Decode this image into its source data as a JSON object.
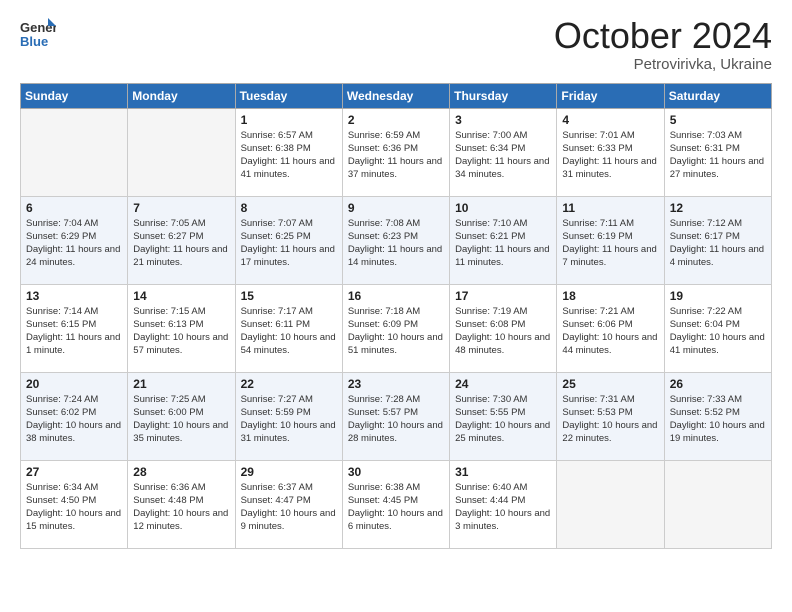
{
  "header": {
    "logo_general": "General",
    "logo_blue": "Blue",
    "month": "October 2024",
    "location": "Petrovirivka, Ukraine"
  },
  "weekdays": [
    "Sunday",
    "Monday",
    "Tuesday",
    "Wednesday",
    "Thursday",
    "Friday",
    "Saturday"
  ],
  "weeks": [
    [
      {
        "day": "",
        "info": ""
      },
      {
        "day": "",
        "info": ""
      },
      {
        "day": "1",
        "info": "Sunrise: 6:57 AM\nSunset: 6:38 PM\nDaylight: 11 hours and 41 minutes."
      },
      {
        "day": "2",
        "info": "Sunrise: 6:59 AM\nSunset: 6:36 PM\nDaylight: 11 hours and 37 minutes."
      },
      {
        "day": "3",
        "info": "Sunrise: 7:00 AM\nSunset: 6:34 PM\nDaylight: 11 hours and 34 minutes."
      },
      {
        "day": "4",
        "info": "Sunrise: 7:01 AM\nSunset: 6:33 PM\nDaylight: 11 hours and 31 minutes."
      },
      {
        "day": "5",
        "info": "Sunrise: 7:03 AM\nSunset: 6:31 PM\nDaylight: 11 hours and 27 minutes."
      }
    ],
    [
      {
        "day": "6",
        "info": "Sunrise: 7:04 AM\nSunset: 6:29 PM\nDaylight: 11 hours and 24 minutes."
      },
      {
        "day": "7",
        "info": "Sunrise: 7:05 AM\nSunset: 6:27 PM\nDaylight: 11 hours and 21 minutes."
      },
      {
        "day": "8",
        "info": "Sunrise: 7:07 AM\nSunset: 6:25 PM\nDaylight: 11 hours and 17 minutes."
      },
      {
        "day": "9",
        "info": "Sunrise: 7:08 AM\nSunset: 6:23 PM\nDaylight: 11 hours and 14 minutes."
      },
      {
        "day": "10",
        "info": "Sunrise: 7:10 AM\nSunset: 6:21 PM\nDaylight: 11 hours and 11 minutes."
      },
      {
        "day": "11",
        "info": "Sunrise: 7:11 AM\nSunset: 6:19 PM\nDaylight: 11 hours and 7 minutes."
      },
      {
        "day": "12",
        "info": "Sunrise: 7:12 AM\nSunset: 6:17 PM\nDaylight: 11 hours and 4 minutes."
      }
    ],
    [
      {
        "day": "13",
        "info": "Sunrise: 7:14 AM\nSunset: 6:15 PM\nDaylight: 11 hours and 1 minute."
      },
      {
        "day": "14",
        "info": "Sunrise: 7:15 AM\nSunset: 6:13 PM\nDaylight: 10 hours and 57 minutes."
      },
      {
        "day": "15",
        "info": "Sunrise: 7:17 AM\nSunset: 6:11 PM\nDaylight: 10 hours and 54 minutes."
      },
      {
        "day": "16",
        "info": "Sunrise: 7:18 AM\nSunset: 6:09 PM\nDaylight: 10 hours and 51 minutes."
      },
      {
        "day": "17",
        "info": "Sunrise: 7:19 AM\nSunset: 6:08 PM\nDaylight: 10 hours and 48 minutes."
      },
      {
        "day": "18",
        "info": "Sunrise: 7:21 AM\nSunset: 6:06 PM\nDaylight: 10 hours and 44 minutes."
      },
      {
        "day": "19",
        "info": "Sunrise: 7:22 AM\nSunset: 6:04 PM\nDaylight: 10 hours and 41 minutes."
      }
    ],
    [
      {
        "day": "20",
        "info": "Sunrise: 7:24 AM\nSunset: 6:02 PM\nDaylight: 10 hours and 38 minutes."
      },
      {
        "day": "21",
        "info": "Sunrise: 7:25 AM\nSunset: 6:00 PM\nDaylight: 10 hours and 35 minutes."
      },
      {
        "day": "22",
        "info": "Sunrise: 7:27 AM\nSunset: 5:59 PM\nDaylight: 10 hours and 31 minutes."
      },
      {
        "day": "23",
        "info": "Sunrise: 7:28 AM\nSunset: 5:57 PM\nDaylight: 10 hours and 28 minutes."
      },
      {
        "day": "24",
        "info": "Sunrise: 7:30 AM\nSunset: 5:55 PM\nDaylight: 10 hours and 25 minutes."
      },
      {
        "day": "25",
        "info": "Sunrise: 7:31 AM\nSunset: 5:53 PM\nDaylight: 10 hours and 22 minutes."
      },
      {
        "day": "26",
        "info": "Sunrise: 7:33 AM\nSunset: 5:52 PM\nDaylight: 10 hours and 19 minutes."
      }
    ],
    [
      {
        "day": "27",
        "info": "Sunrise: 6:34 AM\nSunset: 4:50 PM\nDaylight: 10 hours and 15 minutes."
      },
      {
        "day": "28",
        "info": "Sunrise: 6:36 AM\nSunset: 4:48 PM\nDaylight: 10 hours and 12 minutes."
      },
      {
        "day": "29",
        "info": "Sunrise: 6:37 AM\nSunset: 4:47 PM\nDaylight: 10 hours and 9 minutes."
      },
      {
        "day": "30",
        "info": "Sunrise: 6:38 AM\nSunset: 4:45 PM\nDaylight: 10 hours and 6 minutes."
      },
      {
        "day": "31",
        "info": "Sunrise: 6:40 AM\nSunset: 4:44 PM\nDaylight: 10 hours and 3 minutes."
      },
      {
        "day": "",
        "info": ""
      },
      {
        "day": "",
        "info": ""
      }
    ]
  ]
}
